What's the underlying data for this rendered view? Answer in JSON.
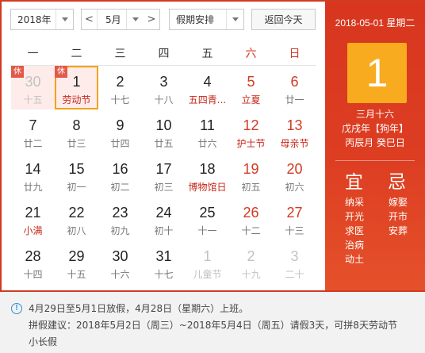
{
  "toolbar": {
    "year_value": "2018年",
    "month_value": "5月",
    "prev_glyph": "<",
    "holiday_value": "假期安排",
    "today_label": "返回今天"
  },
  "weekdays": [
    "一",
    "二",
    "三",
    "四",
    "五",
    "六",
    "日"
  ],
  "calendar": {
    "rest_badge": "休",
    "rows": [
      [
        {
          "d": "30",
          "l": "十五"
        },
        {
          "d": "1",
          "l": "劳动节"
        },
        {
          "d": "2",
          "l": "十七"
        },
        {
          "d": "3",
          "l": "十八"
        },
        {
          "d": "4",
          "l": "五四青..."
        },
        {
          "d": "5",
          "l": "立夏"
        },
        {
          "d": "6",
          "l": "廿一"
        }
      ],
      [
        {
          "d": "7",
          "l": "廿二"
        },
        {
          "d": "8",
          "l": "廿三"
        },
        {
          "d": "9",
          "l": "廿四"
        },
        {
          "d": "10",
          "l": "廿五"
        },
        {
          "d": "11",
          "l": "廿六"
        },
        {
          "d": "12",
          "l": "护士节"
        },
        {
          "d": "13",
          "l": "母亲节"
        }
      ],
      [
        {
          "d": "14",
          "l": "廿九"
        },
        {
          "d": "15",
          "l": "初一"
        },
        {
          "d": "16",
          "l": "初二"
        },
        {
          "d": "17",
          "l": "初三"
        },
        {
          "d": "18",
          "l": "博物馆日"
        },
        {
          "d": "19",
          "l": "初五"
        },
        {
          "d": "20",
          "l": "初六"
        }
      ],
      [
        {
          "d": "21",
          "l": "小满"
        },
        {
          "d": "22",
          "l": "初八"
        },
        {
          "d": "23",
          "l": "初九"
        },
        {
          "d": "24",
          "l": "初十"
        },
        {
          "d": "25",
          "l": "十一"
        },
        {
          "d": "26",
          "l": "十二"
        },
        {
          "d": "27",
          "l": "十三"
        }
      ],
      [
        {
          "d": "28",
          "l": "十四"
        },
        {
          "d": "29",
          "l": "十五"
        },
        {
          "d": "30",
          "l": "十六"
        },
        {
          "d": "31",
          "l": "十七"
        },
        {
          "d": "1",
          "l": "儿童节"
        },
        {
          "d": "2",
          "l": "十九"
        },
        {
          "d": "3",
          "l": "二十"
        }
      ]
    ]
  },
  "detail": {
    "date_line": "2018-05-01 星期二",
    "big_day": "1",
    "lunar_date": "三月十六",
    "year_ganzhi": "戊戌年【狗年】",
    "month_day_ganzhi": "丙辰月 癸巳日",
    "yi_title": "宜",
    "ji_title": "忌",
    "yi_items": [
      "纳采",
      "开光",
      "求医",
      "治病",
      "动土"
    ],
    "ji_items": [
      "嫁娶",
      "开市",
      "安葬"
    ]
  },
  "notice": {
    "icon": "!",
    "line1": "4月29日至5月1日放假，4月28日（星期六）上班。",
    "line2": "拼假建议：2018年5月2日（周三）~2018年5月4日（周五）请假3天，可拼8天劳动节",
    "line3": "小长假"
  },
  "colors": {
    "accent_red": "#d23a22",
    "highlight_orange": "#f8ab1e",
    "rest_pink": "#fdecea"
  }
}
